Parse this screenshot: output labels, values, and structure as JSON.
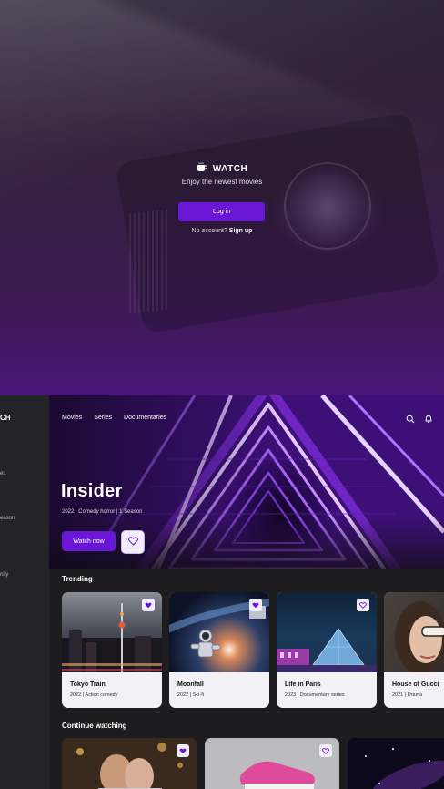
{
  "login": {
    "logo_text": "WATCH",
    "tagline": "Enjoy the newest movies",
    "login_button": "Log in",
    "no_account_text": "No account?",
    "signup_link": "Sign up"
  },
  "sidebar": {
    "logo_partial": "CH",
    "items": [
      "es",
      "eason",
      "nity"
    ]
  },
  "nav": {
    "items": [
      "Movies",
      "Series",
      "Documentaries"
    ]
  },
  "hero": {
    "title": "Insider",
    "meta": "2022 | Comedy horror | 1 Season",
    "watch_button": "Watch now"
  },
  "trending": {
    "title": "Trending",
    "cards": [
      {
        "title": "Tokyo Train",
        "meta": "2022 | Action comedy"
      },
      {
        "title": "Moonfall",
        "meta": "2022 | Sci-fi"
      },
      {
        "title": "Life in Paris",
        "meta": "2023 | Documentary series"
      },
      {
        "title": "House of Gucci",
        "meta": "2021 | Drama"
      }
    ]
  },
  "continue_watching": {
    "title": "Continue watching"
  },
  "colors": {
    "accent": "#6a16d6",
    "background": "#1d1d1f",
    "card_footer": "#f2f1f5"
  },
  "icons": [
    "cup-logo-icon",
    "search-icon",
    "bell-icon",
    "heart-icon"
  ]
}
